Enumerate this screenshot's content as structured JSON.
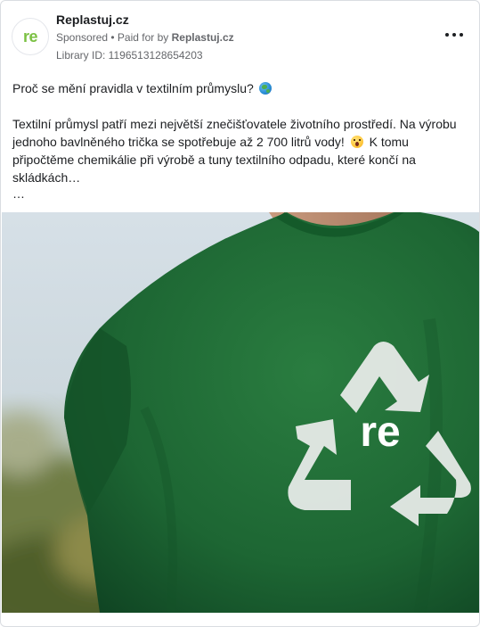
{
  "post": {
    "page_name": "Replastuj.cz",
    "avatar_text": "re",
    "sponsored": "Sponsored",
    "paid_prefix": " • Paid for by ",
    "paid_by": "Replastuj.cz",
    "library_id": "Library ID: 1196513128654203",
    "more_icon": "more-horizontal-icon"
  },
  "text": {
    "headline": "Proč se mění pravidla v textilním průmyslu?",
    "line1": "Textilní průmysl patří mezi největší znečišťovatele životního prostředí. Na výrobu jednoho bavlněného trička se spotřebuje až 2 700 litrů vody!",
    "line2": "K tomu připočtěme chemikálie při výrobě a tuny textilního odpadu, které končí na skládkách…",
    "see_more": "…"
  },
  "media": {
    "logo_text": "re",
    "colors": {
      "shirt": "#1f6b35",
      "shirt_dark": "#124726",
      "sky": "#cfdbe3",
      "print": "#e8ece9"
    }
  }
}
